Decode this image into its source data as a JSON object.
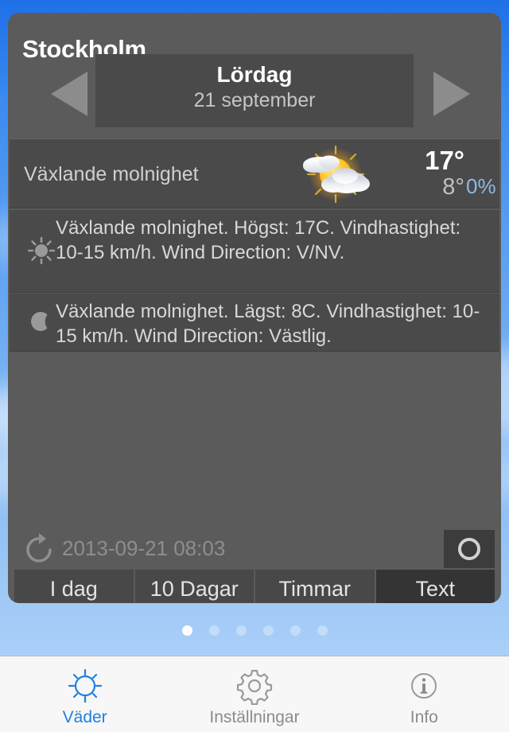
{
  "app": {
    "accent_blue": "#1f7fe0",
    "precip_blue": "#8fb8e8",
    "card_bg": "#5b5b5b",
    "panel_bg": "#4a4a4a"
  },
  "header": {
    "city": "Stockholm",
    "prev_icon": "triangle-left-icon",
    "next_icon": "triangle-right-icon",
    "day_name": "Lördag",
    "day_date": "21 september"
  },
  "current": {
    "condition": "Växlande molnighet",
    "weather_icon": "sun-behind-cloud-icon",
    "temp_high": "17°",
    "temp_low": "8°",
    "precip_chance": "0%"
  },
  "forecast_details": [
    {
      "period_icon": "sun-icon",
      "text": "Växlande molnighet. Högst: 17C. Vindhastighet: 10-15 km/h. Wind Direction: V/NV."
    },
    {
      "period_icon": "moon-icon",
      "text": "Växlande molnighet. Lägst: 8C. Vindhastighet: 10-15 km/h. Wind Direction: Västlig."
    }
  ],
  "footer": {
    "refresh_icon": "refresh-icon",
    "last_updated": "2013-09-21 08:03",
    "circle_button_icon": "ring-icon"
  },
  "segmented": {
    "items": [
      {
        "label": "I dag",
        "active": false
      },
      {
        "label": "10 Dagar",
        "active": false
      },
      {
        "label": "Timmar",
        "active": false
      },
      {
        "label": "Text",
        "active": true
      }
    ]
  },
  "pager": {
    "count": 6,
    "active_index": 0
  },
  "tabbar": {
    "items": [
      {
        "label": "Väder",
        "icon": "sun-outline-icon",
        "active": true
      },
      {
        "label": "Inställningar",
        "icon": "gear-icon",
        "active": false
      },
      {
        "label": "Info",
        "icon": "info-circle-icon",
        "active": false
      }
    ]
  }
}
